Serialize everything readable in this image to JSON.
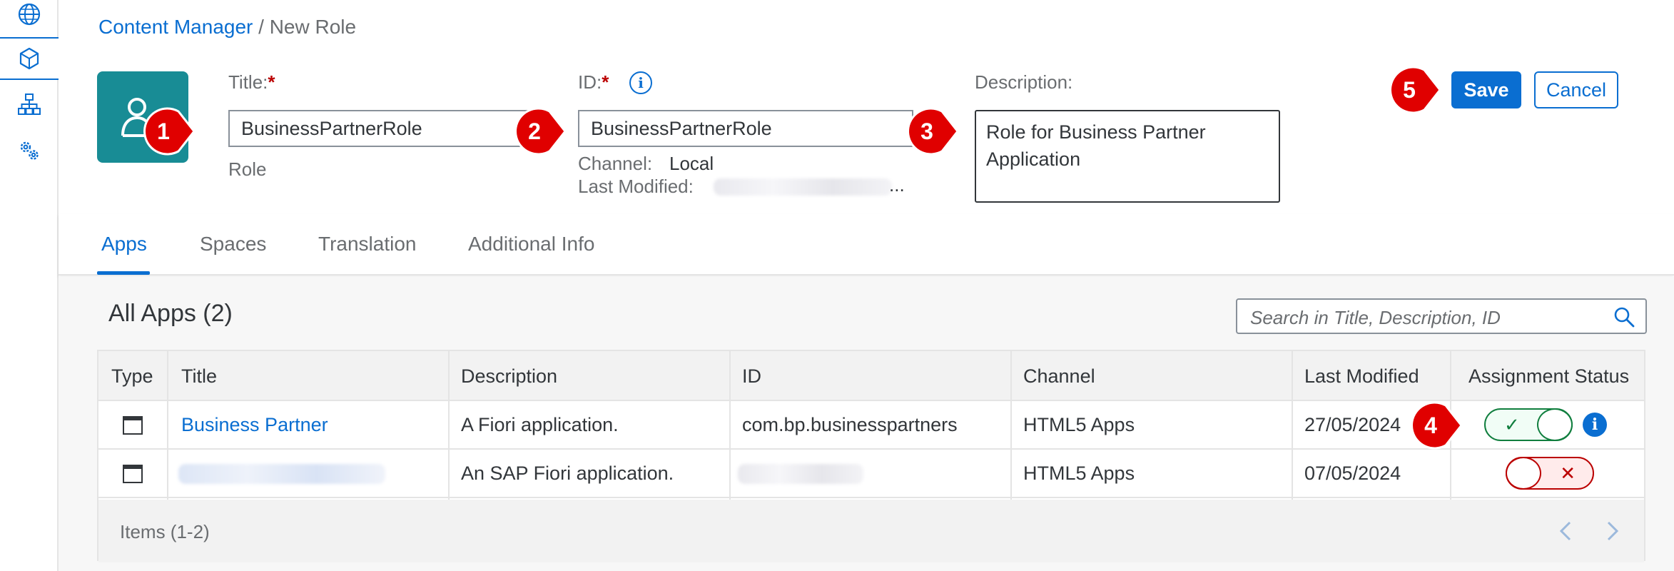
{
  "breadcrumb": {
    "parent": "Content Manager",
    "separator": "/",
    "current": "New Role"
  },
  "header": {
    "role_subtitle": "Role",
    "title_field": {
      "label": "Title:",
      "required": "*",
      "value": "BusinessPartnerRole"
    },
    "id_field": {
      "label": "ID:",
      "required": "*",
      "value": "BusinessPartnerRole",
      "info_glyph": "i"
    },
    "description_field": {
      "label": "Description:",
      "value": "Role for Business Partner Application"
    },
    "channel": {
      "label": "Channel:",
      "value": "Local"
    },
    "last_modified": {
      "label": "Last Modified:",
      "value_ellipsis": "..."
    },
    "save_label": "Save",
    "cancel_label": "Cancel"
  },
  "markers": [
    "1",
    "2",
    "3",
    "4",
    "5"
  ],
  "tabs": [
    {
      "label": "Apps",
      "active": true
    },
    {
      "label": "Spaces",
      "active": false
    },
    {
      "label": "Translation",
      "active": false
    },
    {
      "label": "Additional Info",
      "active": false
    }
  ],
  "apps": {
    "title": "All Apps (2)",
    "search_placeholder": "Search in Title, Description, ID",
    "columns": [
      "Type",
      "Title",
      "Description",
      "ID",
      "Channel",
      "Last Modified",
      "Assignment Status"
    ],
    "rows": [
      {
        "title": "Business Partner",
        "description": "A Fiori application.",
        "id": "com.bp.businesspartners",
        "channel": "HTML5 Apps",
        "last_modified": "27/05/2024",
        "status": "assigned",
        "status_glyph": "✓",
        "info_glyph": "i"
      },
      {
        "title": "",
        "description": "An SAP Fiori application.",
        "id": "",
        "channel": "HTML5 Apps",
        "last_modified": "07/05/2024",
        "status": "unassigned",
        "status_glyph": "✕"
      }
    ],
    "footer": "Items (1-2)"
  },
  "colors": {
    "accent": "#0a6ed1",
    "marker": "#e00000",
    "role_tile": "#188c95",
    "success": "#107e3e",
    "error": "#bb0000"
  },
  "icons": [
    "globe-icon",
    "cube-icon",
    "hierarchy-icon",
    "gears-icon",
    "role-icon",
    "search-icon",
    "app-window-icon",
    "info-icon",
    "chevron-left-icon",
    "chevron-right-icon"
  ]
}
